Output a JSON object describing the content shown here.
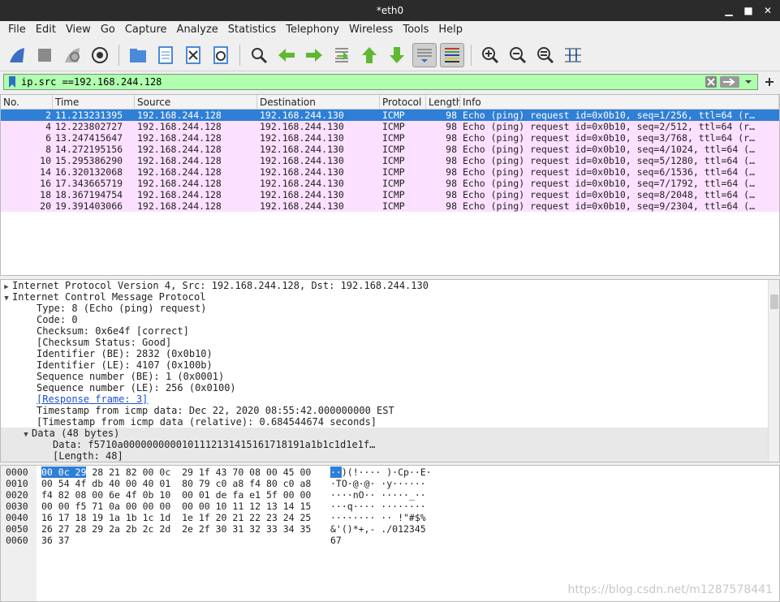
{
  "window": {
    "title": "*eth0",
    "controls": [
      "▁",
      "■",
      "✕"
    ]
  },
  "menu": [
    "File",
    "Edit",
    "View",
    "Go",
    "Capture",
    "Analyze",
    "Statistics",
    "Telephony",
    "Wireless",
    "Tools",
    "Help"
  ],
  "filter": {
    "value": "ip.src ==192.168.244.128"
  },
  "columns": [
    "No.",
    "Time",
    "Source",
    "Destination",
    "Protocol",
    "Length",
    "Info"
  ],
  "packets": [
    {
      "no": "2",
      "time": "11.213231395",
      "src": "192.168.244.128",
      "dst": "192.168.244.130",
      "proto": "ICMP",
      "len": "98",
      "info": "Echo (ping) request  id=0x0b10, seq=1/256, ttl=64 (r…"
    },
    {
      "no": "4",
      "time": "12.223802727",
      "src": "192.168.244.128",
      "dst": "192.168.244.130",
      "proto": "ICMP",
      "len": "98",
      "info": "Echo (ping) request  id=0x0b10, seq=2/512, ttl=64 (r…"
    },
    {
      "no": "6",
      "time": "13.247415647",
      "src": "192.168.244.128",
      "dst": "192.168.244.130",
      "proto": "ICMP",
      "len": "98",
      "info": "Echo (ping) request  id=0x0b10, seq=3/768, ttl=64 (r…"
    },
    {
      "no": "8",
      "time": "14.272195156",
      "src": "192.168.244.128",
      "dst": "192.168.244.130",
      "proto": "ICMP",
      "len": "98",
      "info": "Echo (ping) request  id=0x0b10, seq=4/1024, ttl=64 (…"
    },
    {
      "no": "10",
      "time": "15.295386290",
      "src": "192.168.244.128",
      "dst": "192.168.244.130",
      "proto": "ICMP",
      "len": "98",
      "info": "Echo (ping) request  id=0x0b10, seq=5/1280, ttl=64 (…"
    },
    {
      "no": "14",
      "time": "16.320132068",
      "src": "192.168.244.128",
      "dst": "192.168.244.130",
      "proto": "ICMP",
      "len": "98",
      "info": "Echo (ping) request  id=0x0b10, seq=6/1536, ttl=64 (…"
    },
    {
      "no": "16",
      "time": "17.343665719",
      "src": "192.168.244.128",
      "dst": "192.168.244.130",
      "proto": "ICMP",
      "len": "98",
      "info": "Echo (ping) request  id=0x0b10, seq=7/1792, ttl=64 (…"
    },
    {
      "no": "18",
      "time": "18.367194754",
      "src": "192.168.244.128",
      "dst": "192.168.244.130",
      "proto": "ICMP",
      "len": "98",
      "info": "Echo (ping) request  id=0x0b10, seq=8/2048, ttl=64 (…"
    },
    {
      "no": "20",
      "time": "19.391403066",
      "src": "192.168.244.128",
      "dst": "192.168.244.130",
      "proto": "ICMP",
      "len": "98",
      "info": "Echo (ping) request  id=0x0b10, seq=9/2304, ttl=64 (…"
    }
  ],
  "details": {
    "ip": "Internet Protocol Version 4, Src: 192.168.244.128, Dst: 192.168.244.130",
    "icmp": "Internet Control Message Protocol",
    "type": "Type: 8 (Echo (ping) request)",
    "code": "Code: 0",
    "checksum": "Checksum: 0x6e4f [correct]",
    "checksum_status": "[Checksum Status: Good]",
    "id_be": "Identifier (BE): 2832 (0x0b10)",
    "id_le": "Identifier (LE): 4107 (0x100b)",
    "seq_be": "Sequence number (BE): 1 (0x0001)",
    "seq_le": "Sequence number (LE): 256 (0x0100)",
    "response": "[Response frame: 3]",
    "ts": "Timestamp from icmp data: Dec 22, 2020 08:55:42.000000000 EST",
    "ts_rel": "[Timestamp from icmp data (relative): 0.684544674 seconds]",
    "data": "Data (48 bytes)",
    "data_val": "Data: f5710a0000000000101112131415161718191a1b1c1d1e1f…",
    "data_len": "[Length: 48]"
  },
  "hex": [
    {
      "off": "0000",
      "hl": "00 0c 29",
      "bytes": " 28 21 82 00 0c  29 1f 43 70 08 00 45 00",
      "ahl": "··",
      "ascii": ")(!···· )·Cp··E·"
    },
    {
      "off": "0010",
      "hl": "",
      "bytes": "00 54 4f db 40 00 40 01  80 79 c0 a8 f4 80 c0 a8",
      "ahl": "",
      "ascii": "·TO·@·@· ·y······"
    },
    {
      "off": "0020",
      "hl": "",
      "bytes": "f4 82 08 00 6e 4f 0b 10  00 01 de fa e1 5f 00 00",
      "ahl": "",
      "ascii": "····nO·· ·····_··"
    },
    {
      "off": "0030",
      "hl": "",
      "bytes": "00 00 f5 71 0a 00 00 00  00 00 10 11 12 13 14 15",
      "ahl": "",
      "ascii": "···q···· ········"
    },
    {
      "off": "0040",
      "hl": "",
      "bytes": "16 17 18 19 1a 1b 1c 1d  1e 1f 20 21 22 23 24 25",
      "ahl": "",
      "ascii": "········ ·· !\"#$%"
    },
    {
      "off": "0050",
      "hl": "",
      "bytes": "26 27 28 29 2a 2b 2c 2d  2e 2f 30 31 32 33 34 35",
      "ahl": "",
      "ascii": "&'()*+,- ./012345"
    },
    {
      "off": "0060",
      "hl": "",
      "bytes": "36 37",
      "ahl": "",
      "ascii": "67"
    }
  ],
  "watermark": "https://blog.csdn.net/m1287578441"
}
